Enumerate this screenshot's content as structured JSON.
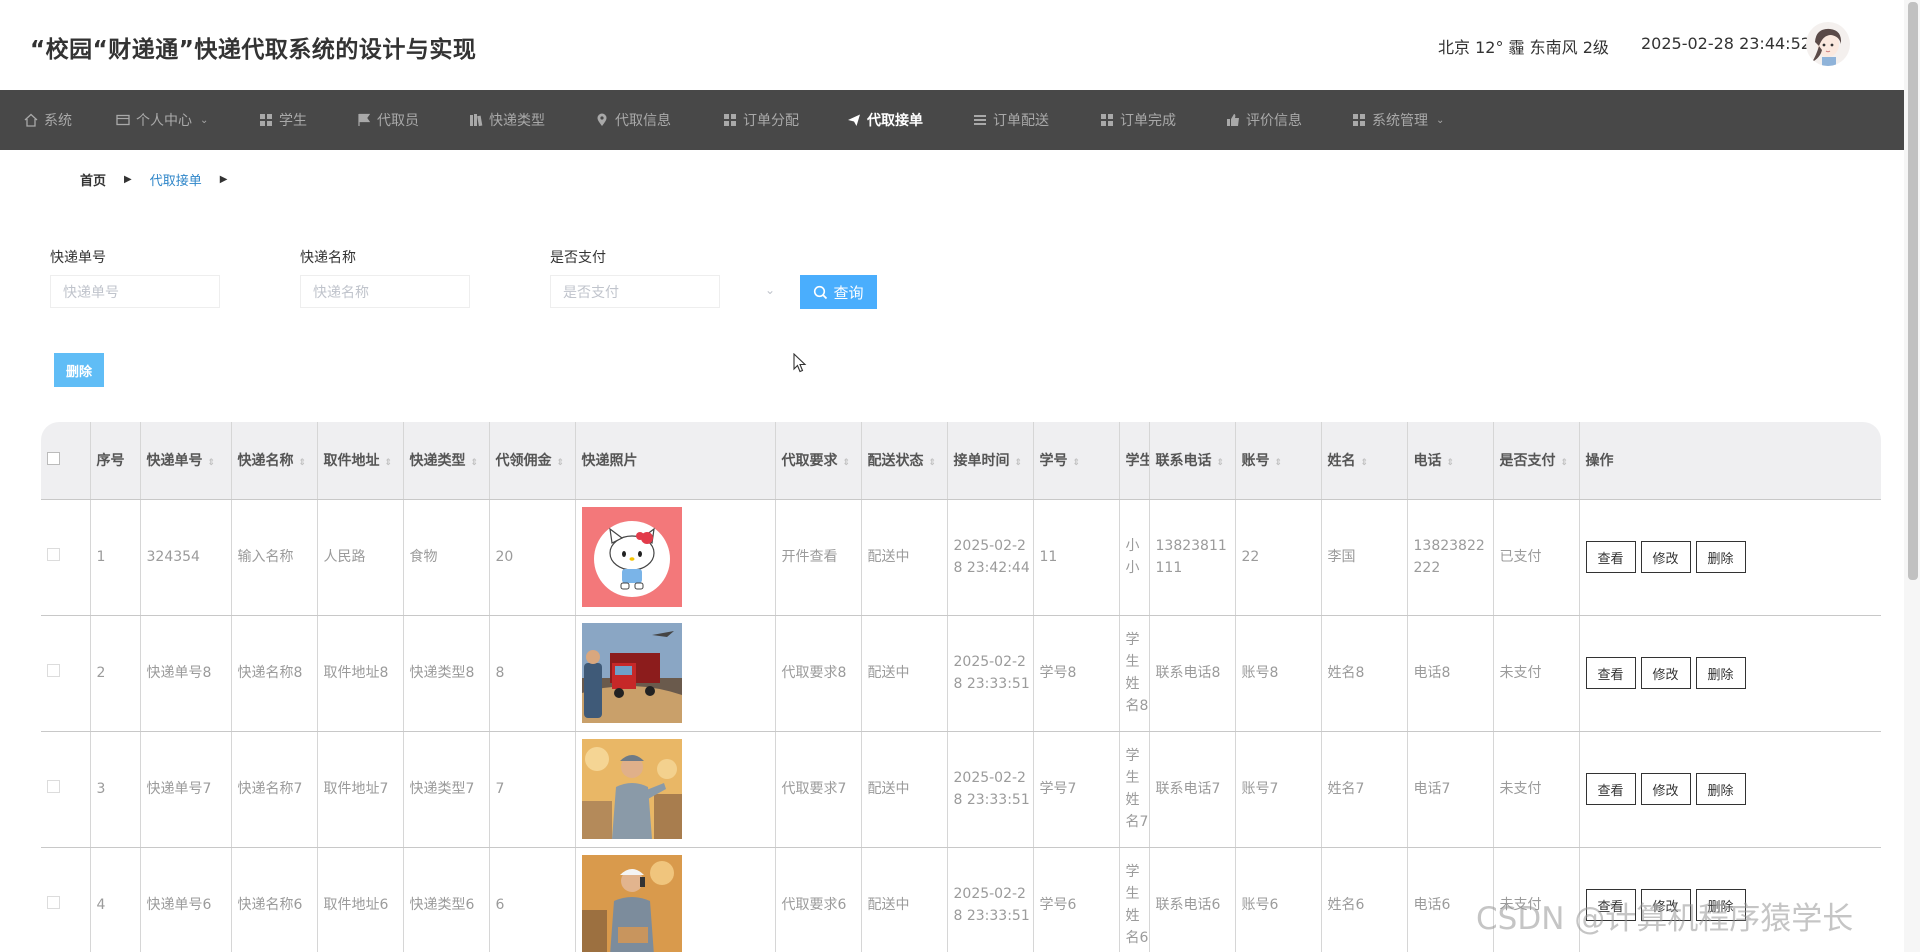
{
  "header": {
    "title": "“校园“财递通”快递代取系统的设计与实现",
    "weather": "北京  12°  霾  东南风  2级",
    "datetime": "2025-02-28 23:44:52"
  },
  "nav": {
    "items": [
      {
        "label": "系统",
        "icon": "home-icon"
      },
      {
        "label": "个人中心",
        "icon": "id-card-icon",
        "has_dropdown": true
      },
      {
        "label": "学生",
        "icon": "grid-icon"
      },
      {
        "label": "代取员",
        "icon": "flag-icon"
      },
      {
        "label": "快递类型",
        "icon": "books-icon"
      },
      {
        "label": "代取信息",
        "icon": "location-pin-icon"
      },
      {
        "label": "订单分配",
        "icon": "grid-icon"
      },
      {
        "label": "代取接单",
        "icon": "paper-plane-icon",
        "active": true
      },
      {
        "label": "订单配送",
        "icon": "list-icon"
      },
      {
        "label": "订单完成",
        "icon": "grid-icon"
      },
      {
        "label": "评价信息",
        "icon": "thumbs-up-icon"
      },
      {
        "label": "系统管理",
        "icon": "grid-icon",
        "has_dropdown": true
      }
    ]
  },
  "breadcrumb": {
    "home": "首页",
    "current": "代取接单"
  },
  "search": {
    "fields": [
      {
        "label": "快递单号",
        "placeholder": "快递单号"
      },
      {
        "label": "快递名称",
        "placeholder": "快递名称"
      },
      {
        "label": "是否支付",
        "placeholder": "是否支付"
      }
    ],
    "query_label": "查询"
  },
  "toolbar": {
    "delete_label": "删除"
  },
  "table": {
    "columns": [
      "序号",
      "快递单号",
      "快递名称",
      "取件地址",
      "快递类型",
      "代领佣金",
      "快递照片",
      "代取要求",
      "配送状态",
      "接单时间",
      "学号",
      "学生",
      "联系电话",
      "账号",
      "姓名",
      "电话",
      "是否支付",
      "操作"
    ],
    "rows": [
      {
        "index": "1",
        "tracking_no": "324354",
        "name": "输入名称",
        "address": "人民路",
        "type": "食物",
        "commission": "20",
        "photo": "hello-kitty",
        "requirement": "开件查看",
        "status": "配送中",
        "time": "2025-02-28 23:42:44",
        "student_no": "11",
        "student": "小小",
        "contact": "13823811111",
        "account": "22",
        "real_name": "李国",
        "phone": "13823822222",
        "paid": "已支付"
      },
      {
        "index": "2",
        "tracking_no": "快递单号8",
        "name": "快递名称8",
        "address": "取件地址8",
        "type": "快递类型8",
        "commission": "8",
        "photo": "truck",
        "requirement": "代取要求8",
        "status": "配送中",
        "time": "2025-02-28 23:33:51",
        "student_no": "学号8",
        "student": "学生姓名8",
        "contact": "联系电话8",
        "account": "账号8",
        "real_name": "姓名8",
        "phone": "电话8",
        "paid": "未支付"
      },
      {
        "index": "3",
        "tracking_no": "快递单号7",
        "name": "快递名称7",
        "address": "取件地址7",
        "type": "快递类型7",
        "commission": "7",
        "photo": "courier",
        "requirement": "代取要求7",
        "status": "配送中",
        "time": "2025-02-28 23:33:51",
        "student_no": "学号7",
        "student": "学生姓名7",
        "contact": "联系电话7",
        "account": "账号7",
        "real_name": "姓名7",
        "phone": "电话7",
        "paid": "未支付"
      },
      {
        "index": "4",
        "tracking_no": "快递单号6",
        "name": "快递名称6",
        "address": "取件地址6",
        "type": "快递类型6",
        "commission": "6",
        "photo": "courier-phone",
        "requirement": "代取要求6",
        "status": "配送中",
        "time": "2025-02-28 23:33:51",
        "student_no": "学号6",
        "student": "学生姓名6",
        "contact": "联系电话6",
        "account": "账号6",
        "real_name": "姓名6",
        "phone": "电话6",
        "paid": "未支付"
      }
    ],
    "row_actions": {
      "view": "查看",
      "edit": "修改",
      "delete": "删除"
    }
  },
  "watermark": "CSDN @计算机程序猿学长",
  "colors": {
    "nav_bg": "#484848",
    "query_button": "#4aaefd",
    "delete_button": "#60bdf6",
    "breadcrumb_active": "#2f86c9",
    "table_header_bg": "#efeff1"
  }
}
